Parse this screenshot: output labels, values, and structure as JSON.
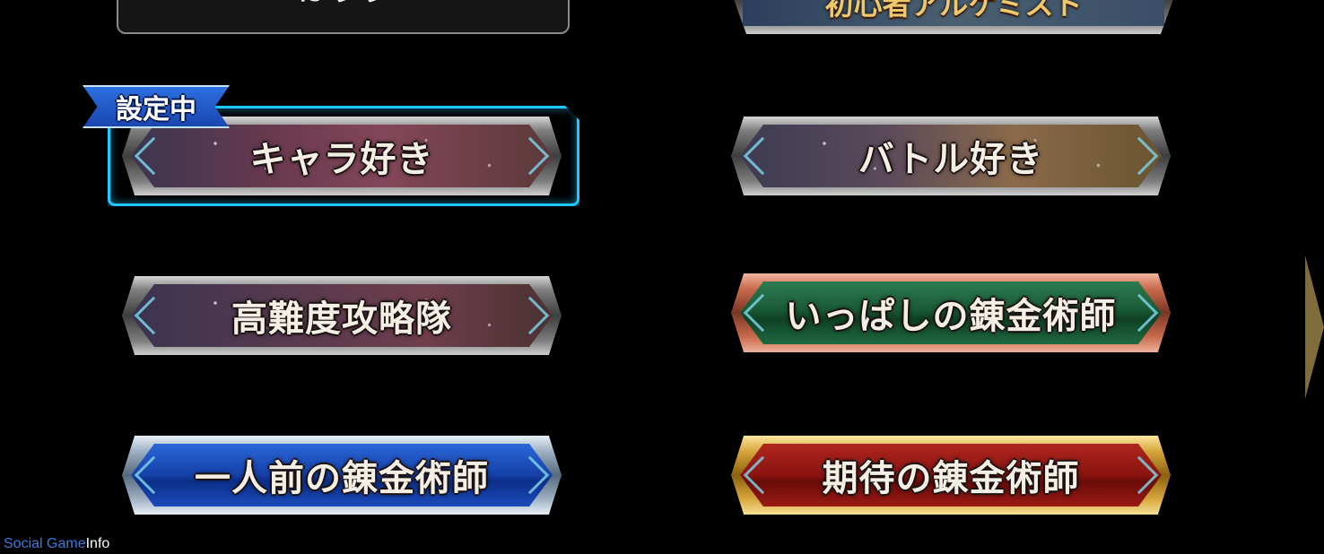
{
  "top_partial": {
    "left_label": "はりり",
    "right_label": "初心者アルケミスト"
  },
  "selected_badge": "設定中",
  "titles": [
    {
      "label": "キャラ好き",
      "variant": "v-chara",
      "selected": true
    },
    {
      "label": "バトル好き",
      "variant": "v-battle",
      "selected": false
    },
    {
      "label": "高難度攻略隊",
      "variant": "v-hard",
      "selected": false
    },
    {
      "label": "いっぱしの錬金術師",
      "variant": "v-green",
      "selected": false
    },
    {
      "label": "一人前の錬金術師",
      "variant": "v-blue",
      "selected": false
    },
    {
      "label": "期待の錬金術師",
      "variant": "v-red",
      "selected": false
    }
  ],
  "watermark": {
    "part1": "Social Game",
    "part2": "Info"
  },
  "colors": {
    "selected_glow": "#1fc9ff",
    "badge_blue": "#2d6fe0",
    "watermark_blue": "#3b7bdc"
  }
}
